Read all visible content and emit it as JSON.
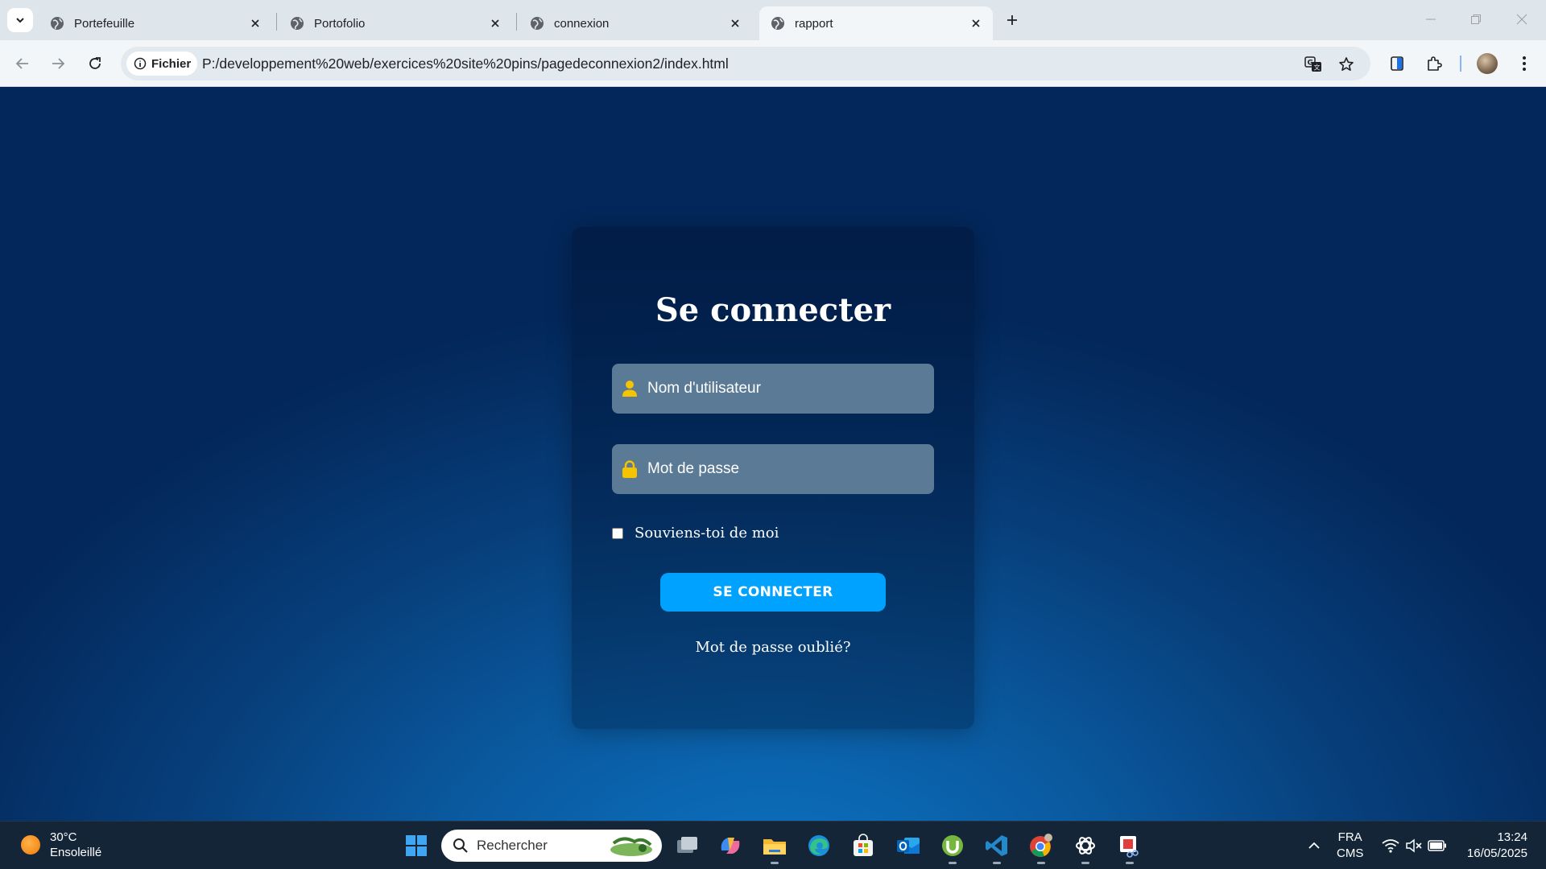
{
  "browser": {
    "tabs": [
      {
        "label": "Portefeuille",
        "active": false
      },
      {
        "label": "Portofolio",
        "active": false
      },
      {
        "label": "connexion",
        "active": false
      },
      {
        "label": "rapport",
        "active": true
      }
    ],
    "site_info_label": "Fichier",
    "url": "P:/developpement%20web/exercices%20site%20pins/pagedeconnexion2/index.html"
  },
  "login": {
    "title": "Se connecter",
    "username_placeholder": "Nom d'utilisateur",
    "password_placeholder": "Mot de passe",
    "remember_label": "Souviens-toi de moi",
    "remember_checked": false,
    "submit_label": "SE CONNECTER",
    "forgot_label": "Mot de passe oublié?"
  },
  "colors": {
    "button": "#00a2ff",
    "field": "#5b7a95",
    "icon": "#f5c400"
  },
  "taskbar": {
    "weather_temp": "30°C",
    "weather_desc": "Ensoleillé",
    "search_placeholder": "Rechercher",
    "apps": [
      "start-icon",
      "task-view-icon",
      "copilot-icon",
      "file-explorer-icon",
      "edge-icon",
      "store-icon",
      "outlook-icon",
      "utorrent-icon",
      "vscode-icon",
      "chrome-icon",
      "chatgpt-icon",
      "snipping-tool-icon"
    ],
    "language": "FRA",
    "input_method": "CMS",
    "time": "13:24",
    "date": "16/05/2025"
  }
}
